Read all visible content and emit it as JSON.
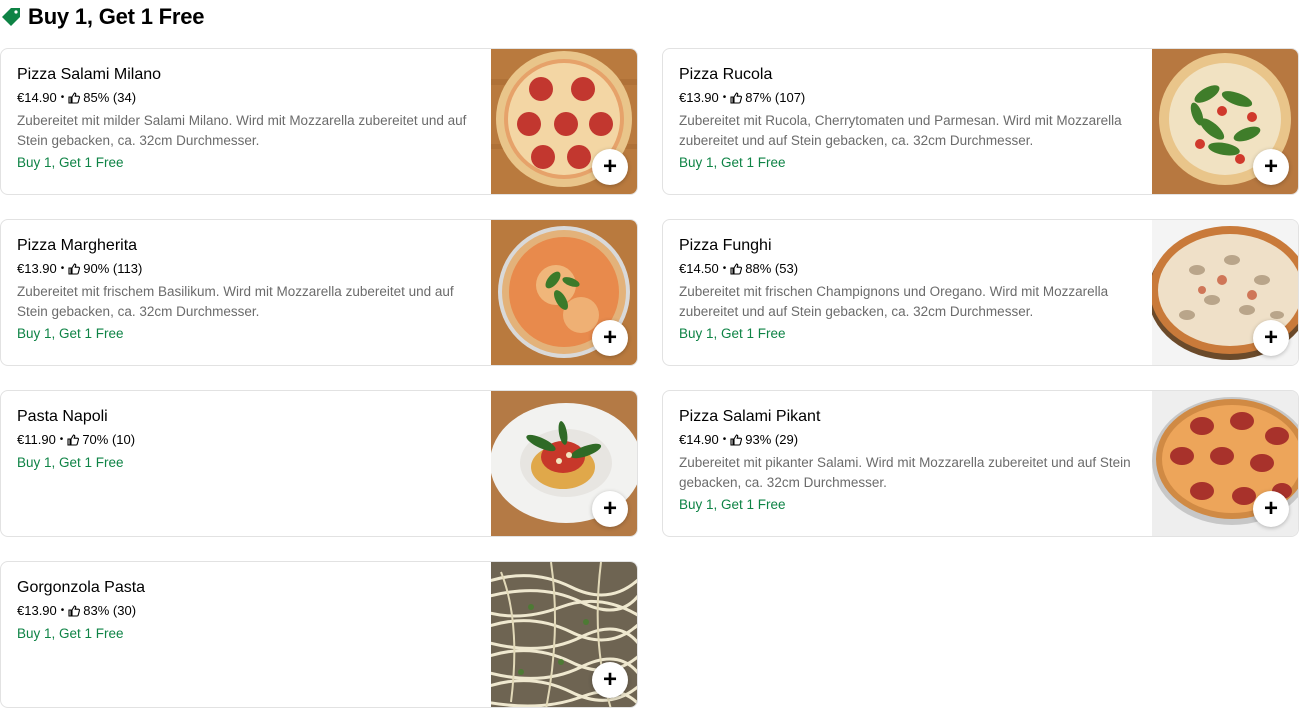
{
  "section": {
    "title": "Buy 1, Get 1 Free",
    "icon": "tag-icon",
    "accent_color": "#0e8345"
  },
  "items": [
    {
      "name": "Pizza Salami Milano",
      "price": "€14.90",
      "rating": "85% (34)",
      "description": "Zubereitet mit milder Salami Milano. Wird mit Mozzarella zubereitet und auf Stein gebacken, ca. 32cm Durchmesser.",
      "promo": "Buy 1, Get 1 Free",
      "image": "pizza-salami-image"
    },
    {
      "name": "Pizza Rucola",
      "price": "€13.90",
      "rating": "87% (107)",
      "description": "Zubereitet mit Rucola, Cherrytomaten und Parmesan. Wird mit Mozzarella zubereitet und auf Stein gebacken, ca. 32cm Durchmesser.",
      "promo": "Buy 1, Get 1 Free",
      "image": "pizza-rucola-image"
    },
    {
      "name": "Pizza Margherita",
      "price": "€13.90",
      "rating": "90% (113)",
      "description": "Zubereitet mit frischem Basilikum. Wird mit Mozzarella zubereitet und auf Stein gebacken, ca. 32cm Durchmesser.",
      "promo": "Buy 1, Get 1 Free",
      "image": "pizza-margherita-image"
    },
    {
      "name": "Pizza Funghi",
      "price": "€14.50",
      "rating": "88% (53)",
      "description": "Zubereitet mit frischen Champignons und Oregano. Wird mit Mozzarella zubereitet und auf Stein gebacken, ca. 32cm Durchmesser.",
      "promo": "Buy 1, Get 1 Free",
      "image": "pizza-funghi-image"
    },
    {
      "name": "Pasta Napoli",
      "price": "€11.90",
      "rating": "70% (10)",
      "description": "",
      "promo": "Buy 1, Get 1 Free",
      "image": "pasta-napoli-image"
    },
    {
      "name": "Pizza Salami Pikant",
      "price": "€14.90",
      "rating": "93% (29)",
      "description": "Zubereitet mit pikanter Salami. Wird mit Mozzarella zubereitet und auf Stein gebacken, ca. 32cm Durchmesser.",
      "promo": "Buy 1, Get 1 Free",
      "image": "pizza-salami-pikant-image"
    },
    {
      "name": "Gorgonzola Pasta",
      "price": "€13.90",
      "rating": "83% (30)",
      "description": "",
      "promo": "Buy 1, Get 1 Free",
      "image": "gorgonzola-pasta-image"
    }
  ],
  "add_button_label": "+",
  "meta_separator": "•"
}
